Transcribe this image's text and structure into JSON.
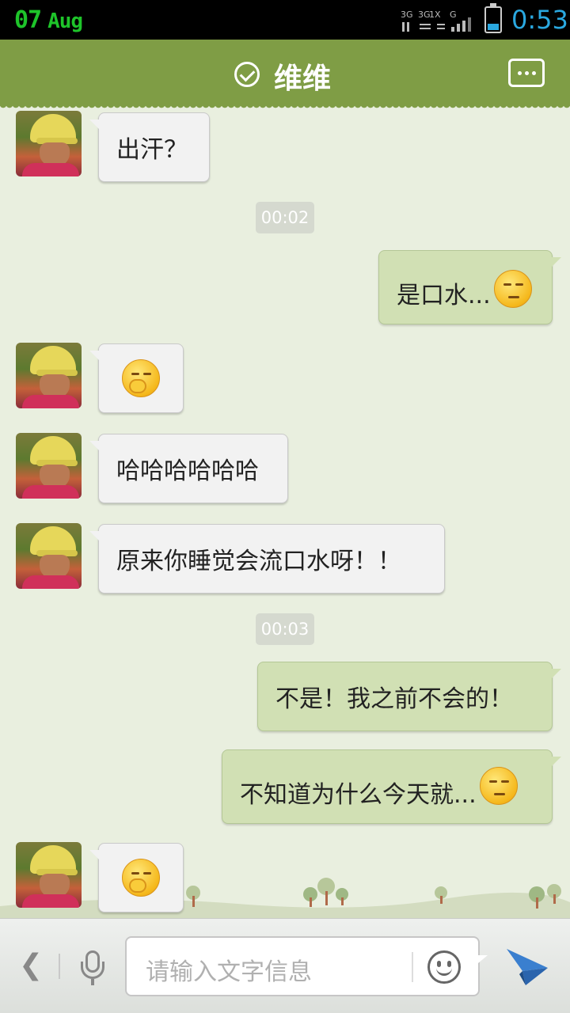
{
  "status_bar": {
    "date_day": "07",
    "date_month": "Aug",
    "time": "0:53",
    "battery_level": 0.3,
    "accent": "#2aa8e0"
  },
  "header": {
    "title": "维维",
    "verified_icon": "check-circle-icon",
    "menu_icon": "chat-menu-icon",
    "color": "#7f9d45"
  },
  "messages": [
    {
      "side": "in",
      "text": "出汗？"
    },
    {
      "type": "time",
      "text": "00:02"
    },
    {
      "side": "out",
      "text": "是口水...",
      "emoji": "drool-face"
    },
    {
      "side": "in",
      "text": "",
      "emoji": "covering-mouth-laugh"
    },
    {
      "side": "in",
      "text": "哈哈哈哈哈哈"
    },
    {
      "side": "in",
      "text": "原来你睡觉会流口水呀！！"
    },
    {
      "type": "time",
      "text": "00:03"
    },
    {
      "side": "out",
      "text": "不是！我之前不会的！"
    },
    {
      "side": "out",
      "text": "不知道为什么今天就...",
      "emoji": "annoyed-face"
    },
    {
      "side": "in",
      "text": "",
      "emoji": "covering-mouth-laugh"
    }
  ],
  "input_bar": {
    "placeholder": "请输入文字信息",
    "back_icon": "chevron-left-icon",
    "voice_icon": "microphone-icon",
    "emoji_icon": "smiley-icon",
    "send_icon": "paper-plane-icon"
  }
}
